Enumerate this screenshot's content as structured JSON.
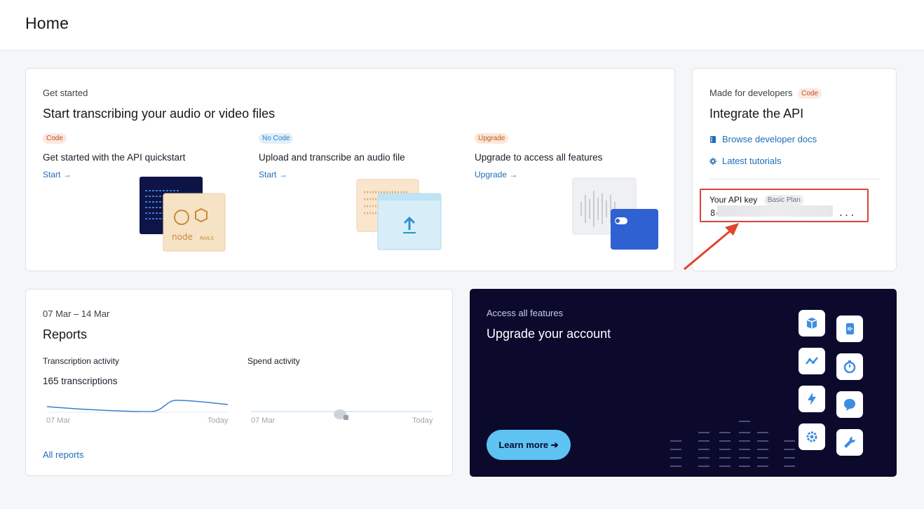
{
  "header": {
    "title": "Home"
  },
  "get_started": {
    "eyebrow": "Get started",
    "title": "Start transcribing your audio or video files",
    "columns": [
      {
        "badge": "Code",
        "title": "Get started with the API quickstart",
        "link": "Start →"
      },
      {
        "badge": "No Code",
        "title": "Upload and transcribe an audio file",
        "link": "Start →"
      },
      {
        "badge": "Upgrade",
        "title": "Upgrade to access all features",
        "link": "Upgrade →"
      }
    ],
    "illustration_text": {
      "node": "node",
      "rails": "RAILS"
    }
  },
  "developers": {
    "eyebrow": "Made for developers",
    "badge": "Code",
    "title": "Integrate the API",
    "links": [
      {
        "label": "Browse developer docs",
        "icon": "book-icon"
      },
      {
        "label": "Latest tutorials",
        "icon": "gear-icon"
      }
    ],
    "api_key": {
      "label": "Your API key",
      "plan_badge": "Basic Plan",
      "value_prefix": "8cf",
      "value_suffix": "..."
    }
  },
  "reports": {
    "date_range": "07 Mar – 14 Mar",
    "title": "Reports",
    "transcription": {
      "heading": "Transcription activity",
      "summary": "165 transcriptions",
      "x_start": "07 Mar",
      "x_end": "Today"
    },
    "spend": {
      "heading": "Spend activity",
      "x_start": "07 Mar",
      "x_end": "Today"
    },
    "all_link": "All reports"
  },
  "upgrade": {
    "eyebrow": "Access all features",
    "title": "Upgrade your account",
    "button": "Learn more ➔",
    "icons": [
      "box-icon",
      "phone-audio-icon",
      "trend-line-icon",
      "stopwatch-icon",
      "lightning-icon",
      "chat-bubble-icon",
      "settings-cog-icon",
      "wrench-icon"
    ]
  },
  "colors": {
    "link": "#1d6fb8",
    "accent_button": "#5ec3f2",
    "dark_card": "#0b0a2d",
    "highlight": "#d9443a"
  }
}
